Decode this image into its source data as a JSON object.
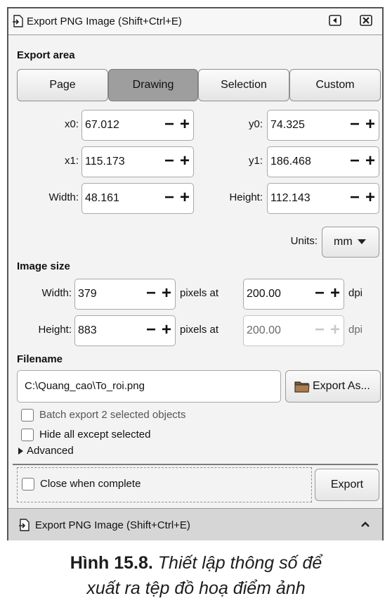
{
  "window": {
    "title": "Export PNG Image (Shift+Ctrl+E)"
  },
  "export_area": {
    "label": "Export area",
    "tabs": [
      "Page",
      "Drawing",
      "Selection",
      "Custom"
    ],
    "active_tab": "Drawing",
    "x0": {
      "label": "x0:",
      "value": "67.012"
    },
    "y0": {
      "label": "y0:",
      "value": "74.325"
    },
    "x1": {
      "label": "x1:",
      "value": "115.173"
    },
    "y1": {
      "label": "y1:",
      "value": "186.468"
    },
    "width": {
      "label": "Width:",
      "value": "48.161"
    },
    "height": {
      "label": "Height:",
      "value": "112.143"
    },
    "units_label": "Units:",
    "units_value": "mm"
  },
  "image_size": {
    "label": "Image size",
    "width": {
      "label": "Width:",
      "value": "379",
      "pixels_at": "pixels at",
      "dpi_value": "200.00",
      "dpi": "dpi"
    },
    "height": {
      "label": "Height:",
      "value": "883",
      "pixels_at": "pixels at",
      "dpi_value": "200.00",
      "dpi": "dpi"
    }
  },
  "filename": {
    "label": "Filename",
    "value": "C:\\Quang_cao\\To_roi.png",
    "export_as_label": "Export As..."
  },
  "options": {
    "batch_export": "Batch export 2 selected objects",
    "hide_all": "Hide all except selected",
    "advanced": "Advanced",
    "close_when_complete": "Close when complete"
  },
  "export_button": "Export",
  "footer_tab": "Export PNG Image (Shift+Ctrl+E)",
  "caption": {
    "number": "Hình 15.8.",
    "line1": "Thiết lập thông số để",
    "line2": "xuất ra tệp đồ hoạ điểm ảnh"
  },
  "icons": [
    "export-file-icon",
    "dock-icon",
    "close-icon",
    "dropdown-arrow-icon",
    "folder-icon",
    "expander-arrow-icon",
    "collapse-up-icon"
  ]
}
